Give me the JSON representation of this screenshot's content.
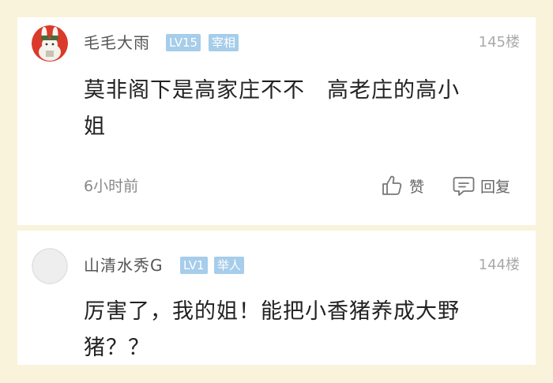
{
  "comments": [
    {
      "username": "毛毛大雨",
      "level": "LV15",
      "title": "宰相",
      "floor": "145楼",
      "text": "莫非阁下是高家庄不不　高老庄的高小\n姐",
      "time": "6小时前",
      "like_label": "赞",
      "reply_label": "回复",
      "avatar_icon": "rabbit-avatar-icon"
    },
    {
      "username": "山清水秀G",
      "level": "LV1",
      "title": "举人",
      "floor": "144楼",
      "text": "厉害了，我的姐！能把小香猪养成大野\n猪？？",
      "avatar_icon": "default-avatar-icon"
    }
  ],
  "colors": {
    "background": "#f9f3dc",
    "badge": "#a6cdea",
    "card": "#ffffff"
  }
}
